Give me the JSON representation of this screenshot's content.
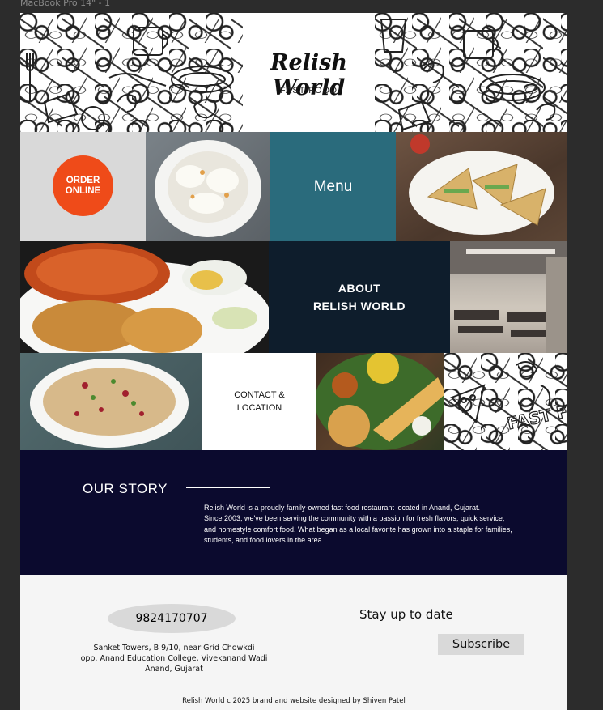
{
  "frame_label": "MacBook Pro 14\" - 1",
  "header": {
    "brand": "Relish World",
    "tagline": "FAST FOOD"
  },
  "tiles": {
    "order_online": "ORDER\nONLINE",
    "menu": "Menu",
    "about": "ABOUT\nRELISH WORLD",
    "contact": "CONTACT &\nLOCATION",
    "doodle_text": "FAST FOOD"
  },
  "story": {
    "title": "OUR STORY",
    "text": "Relish World is a proudly family-owned fast food restaurant located in Anand, Gujarat.\nSince 2003, we've been serving the community with a passion for fresh flavors, quick service,\n and homestyle comfort food. What began as a local favorite has grown into a staple for families,\nstudents, and food lovers in the area."
  },
  "footer": {
    "phone": "9824170707",
    "address_lines": [
      "Sanket Towers, B 9/10, near Grid Chowkdi",
      "opp. Anand Education College, Vivekanand Wadi",
      "Anand, Gujarat"
    ],
    "stay_title": "Stay up to date",
    "email_placeholder": "",
    "subscribe_label": "Subscribe",
    "copyright": "Relish World c 2025 brand and website designed by Shiven Patel"
  },
  "colors": {
    "order_button": "#ef4b19",
    "menu_tile": "#2a6b7c",
    "about_tile": "#0e1d2c",
    "story_bg": "#0b0a2e"
  }
}
